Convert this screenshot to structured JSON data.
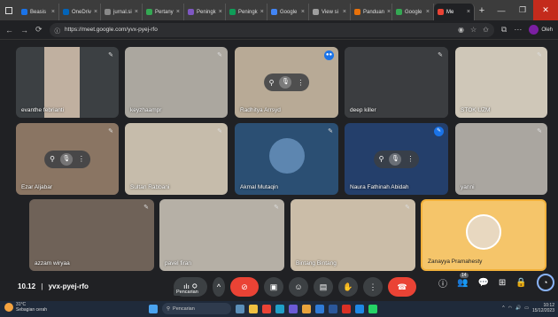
{
  "browser": {
    "tabs": [
      {
        "label": "Beasis",
        "color": "#1a73e8"
      },
      {
        "label": "OneDriv",
        "color": "#0364b8"
      },
      {
        "label": "jurnal.si",
        "color": "#888888"
      },
      {
        "label": "Pertany",
        "color": "#34a853"
      },
      {
        "label": "Peningk",
        "color": "#7e57c2"
      },
      {
        "label": "Peningk",
        "color": "#0f9d58"
      },
      {
        "label": "Google",
        "color": "#4285f4"
      },
      {
        "label": "View si",
        "color": "#9e9e9e"
      },
      {
        "label": "Panduan",
        "color": "#e8710a"
      },
      {
        "label": "Google",
        "color": "#34a853"
      },
      {
        "label": "Me",
        "color": "#ea4335",
        "active": true
      }
    ],
    "new_tab": "+",
    "url": "https://meet.google.com/yvx-pyej-rfo",
    "profile_label": "Oleh"
  },
  "participants": [
    {
      "name": "evanthe febrianti",
      "photo": "#8a7a6a"
    },
    {
      "name": "keyzhaampr",
      "photo": "#b0aba2"
    },
    {
      "name": "Radhitya Arrsyd",
      "photo": "#a99a86"
    },
    {
      "name": "deep killer",
      "photo": "#555"
    },
    {
      "name": "STOK UZM",
      "photo": "#c9c1b2"
    },
    {
      "name": "Ezar Aljabar",
      "photo": "#7d6a5b"
    },
    {
      "name": "Sultan Rabbani",
      "photo": "#c2b8a8"
    },
    {
      "name": "Akmal Mutaqin",
      "photo": "#2b5f8a"
    },
    {
      "name": "Naura Fathinah Abidah",
      "photo": "#2c4a7a"
    },
    {
      "name": "yanni",
      "photo": "#a4a19c"
    },
    {
      "name": "azzam wiryaa",
      "photo": "#6a5d52"
    },
    {
      "name": "pavel firan",
      "photo": "#b3ada3"
    },
    {
      "name": "Bintang Bintang",
      "photo": "#c7b9a4"
    },
    {
      "name": "Zanayya Pramahesty",
      "photo": "#f2b13b"
    }
  ],
  "meeting": {
    "time": "10.12",
    "separator": "|",
    "code": "yvx-pyej-rfo",
    "tooltip": "Pencarian",
    "people_count": "14"
  },
  "taskbar": {
    "weather_temp": "31°C",
    "weather_desc": "Sebagian cerah",
    "search_placeholder": "Pencarian",
    "time": "10:12",
    "date": "15/12/2023"
  }
}
